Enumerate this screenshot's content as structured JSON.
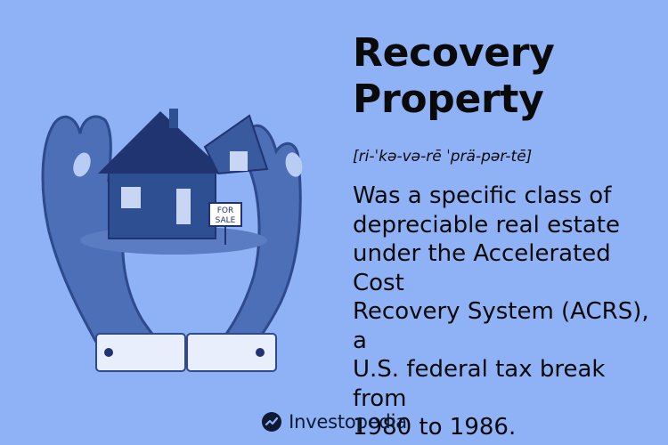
{
  "term": {
    "title_line1": "Recovery",
    "title_line2": "Property",
    "pronunciation": "[ri-ˈkə-və-rē ˈprä-pər-tē]"
  },
  "definition": [
    "Was a specific class of",
    "depreciable real estate",
    "under the Accelerated Cost",
    "Recovery System (ACRS), a",
    "U.S. federal tax break from",
    "1980 to 1986."
  ],
  "sign": {
    "line1": "FOR",
    "line2": "SALE"
  },
  "footer": {
    "brand": "Investopedia"
  },
  "colors": {
    "background": "#8fb1f5",
    "hand": "#4c6fb8",
    "hand_dark": "#2e4a8c",
    "house": "#2f4f93",
    "roof": "#1f3470",
    "cuff": "#e8eefc"
  },
  "icons": [
    "hands-illustration",
    "house-icon",
    "for-sale-sign",
    "investopedia-logo-icon"
  ]
}
